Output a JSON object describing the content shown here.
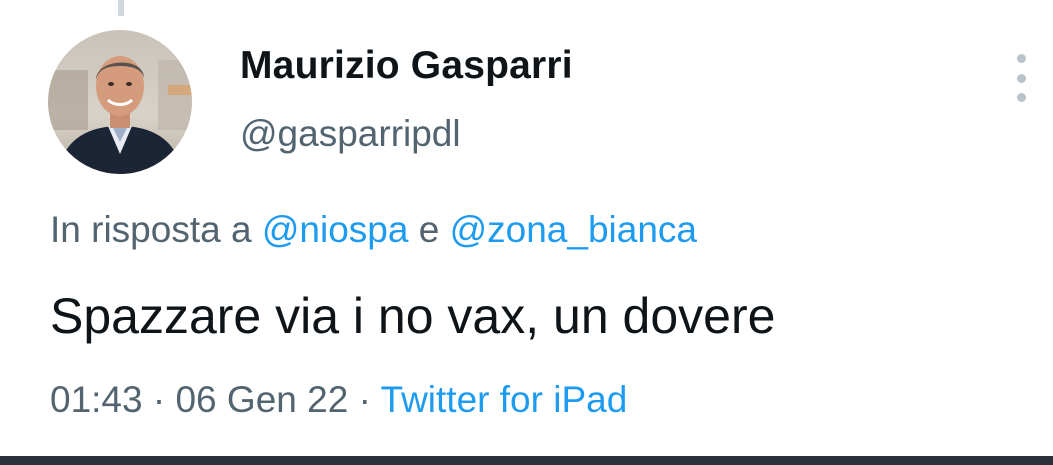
{
  "author": {
    "name": "Maurizio Gasparri",
    "handle": "@gasparripdl",
    "avatar_icon": "profile-photo"
  },
  "reply": {
    "prefix": "In risposta a",
    "mention_1": "@niospa",
    "joiner": "e",
    "mention_2": "@zona_bianca"
  },
  "tweet": {
    "text": "Spazzare via i no vax, un dovere"
  },
  "meta": {
    "time": "01:43",
    "separator": "·",
    "date": "06 Gen 22",
    "source": "Twitter for iPad"
  },
  "menu_icon": "more-vertical-icon",
  "colors": {
    "text_primary": "#0f1419",
    "text_secondary": "#536471",
    "link": "#1d9bf0",
    "thread_line": "#cfd9de"
  }
}
